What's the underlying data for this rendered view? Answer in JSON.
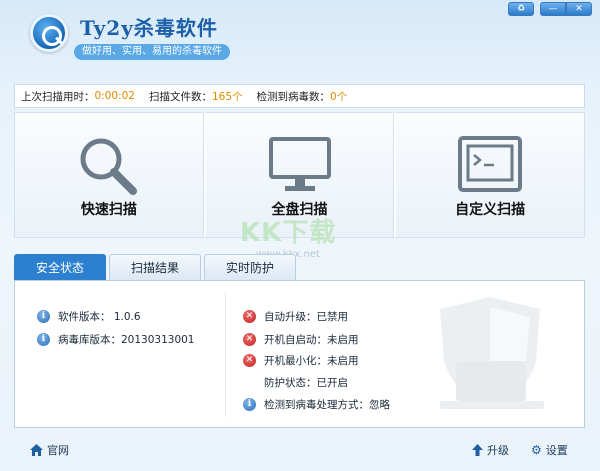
{
  "header": {
    "app_title": "Ty2y杀毒软件",
    "slogan": "做好用、实用、易用的杀毒软件",
    "window_buttons": {
      "skin": "♻",
      "minimize": "—",
      "close": "✕"
    }
  },
  "stats": {
    "last_scan_label": "上次扫描用时：",
    "last_scan_value": "0:00:02",
    "files_label": "扫描文件数：",
    "files_value": "165个",
    "virus_label": "检测到病毒数：",
    "virus_value": "0个"
  },
  "scan_buttons": [
    {
      "label": "快速扫描",
      "icon": "magnifier-icon"
    },
    {
      "label": "全盘扫描",
      "icon": "monitor-icon"
    },
    {
      "label": "自定义扫描",
      "icon": "terminal-window-icon"
    }
  ],
  "watermark": {
    "text": "KK下载",
    "url": "www.kkx.net"
  },
  "tabs": [
    {
      "label": "安全状态",
      "active": true
    },
    {
      "label": "扫描结果",
      "active": false
    },
    {
      "label": "实时防护",
      "active": false
    }
  ],
  "status": {
    "software_version": "软件版本：  1.0.6",
    "virus_db_version": "病毒库版本：20130313001",
    "auto_upgrade": "自动升级：已禁用",
    "auto_start": "开机自启动：未启用",
    "start_minimized": "开机最小化：未启用",
    "protection": "防护状态：已开启",
    "virus_action": "检测到病毒处理方式：忽略"
  },
  "footer": {
    "homepage": "官网",
    "upgrade": "升级",
    "settings": "设置"
  },
  "colors": {
    "accent": "#2d7fd0",
    "stat_value": "#e08a00",
    "error": "#c21f1f"
  }
}
